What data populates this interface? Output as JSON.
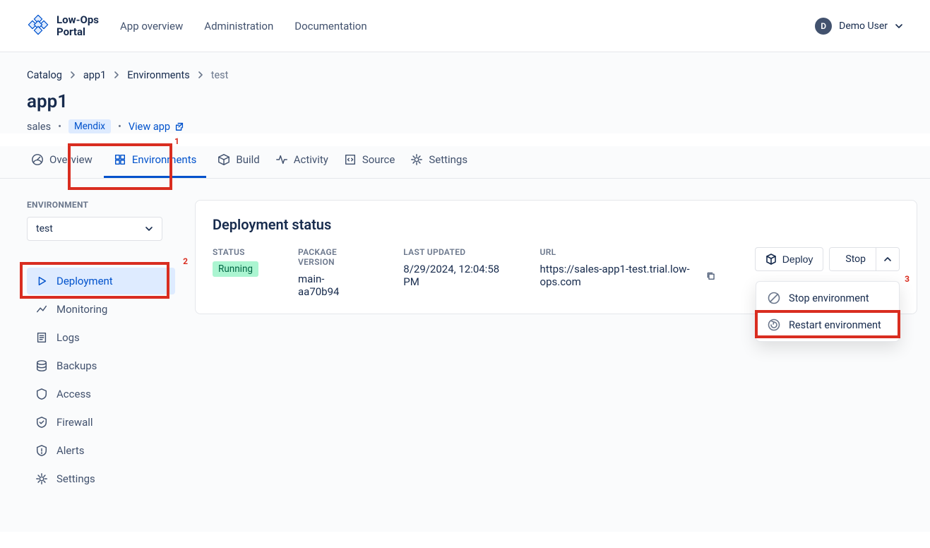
{
  "brand": {
    "line1": "Low-Ops",
    "line2": "Portal"
  },
  "topnav": {
    "overview": "App overview",
    "admin": "Administration",
    "docs": "Documentation"
  },
  "user": {
    "initial": "D",
    "name": "Demo User"
  },
  "breadcrumb": {
    "a": "Catalog",
    "b": "app1",
    "c": "Environments",
    "d": "test"
  },
  "page": {
    "title": "app1",
    "team": "sales",
    "pill": "Mendix",
    "view": "View app"
  },
  "tabs": {
    "overview": "Overview",
    "env": "Environments",
    "build": "Build",
    "activity": "Activity",
    "source": "Source",
    "settings": "Settings"
  },
  "side": {
    "envLabel": "ENVIRONMENT",
    "envValue": "test",
    "deployment": "Deployment",
    "monitoring": "Monitoring",
    "logs": "Logs",
    "backups": "Backups",
    "access": "Access",
    "firewall": "Firewall",
    "alerts": "Alerts",
    "settings": "Settings"
  },
  "panel": {
    "title": "Deployment status",
    "status": {
      "lbl": "STATUS",
      "val": "Running"
    },
    "pkg": {
      "lbl": "PACKAGE VERSION",
      "val": "main-aa70b94"
    },
    "upd": {
      "lbl": "LAST UPDATED",
      "val": "8/29/2024, 12:04:58 PM"
    },
    "url": {
      "lbl": "URL",
      "val": "https://sales-app1-test.trial.low-ops.com"
    }
  },
  "actions": {
    "deploy": "Deploy",
    "stop": "Stop"
  },
  "dropdown": {
    "stop": "Stop environment",
    "restart": "Restart environment"
  },
  "annot": {
    "n1": "1",
    "n2": "2",
    "n3": "3"
  }
}
